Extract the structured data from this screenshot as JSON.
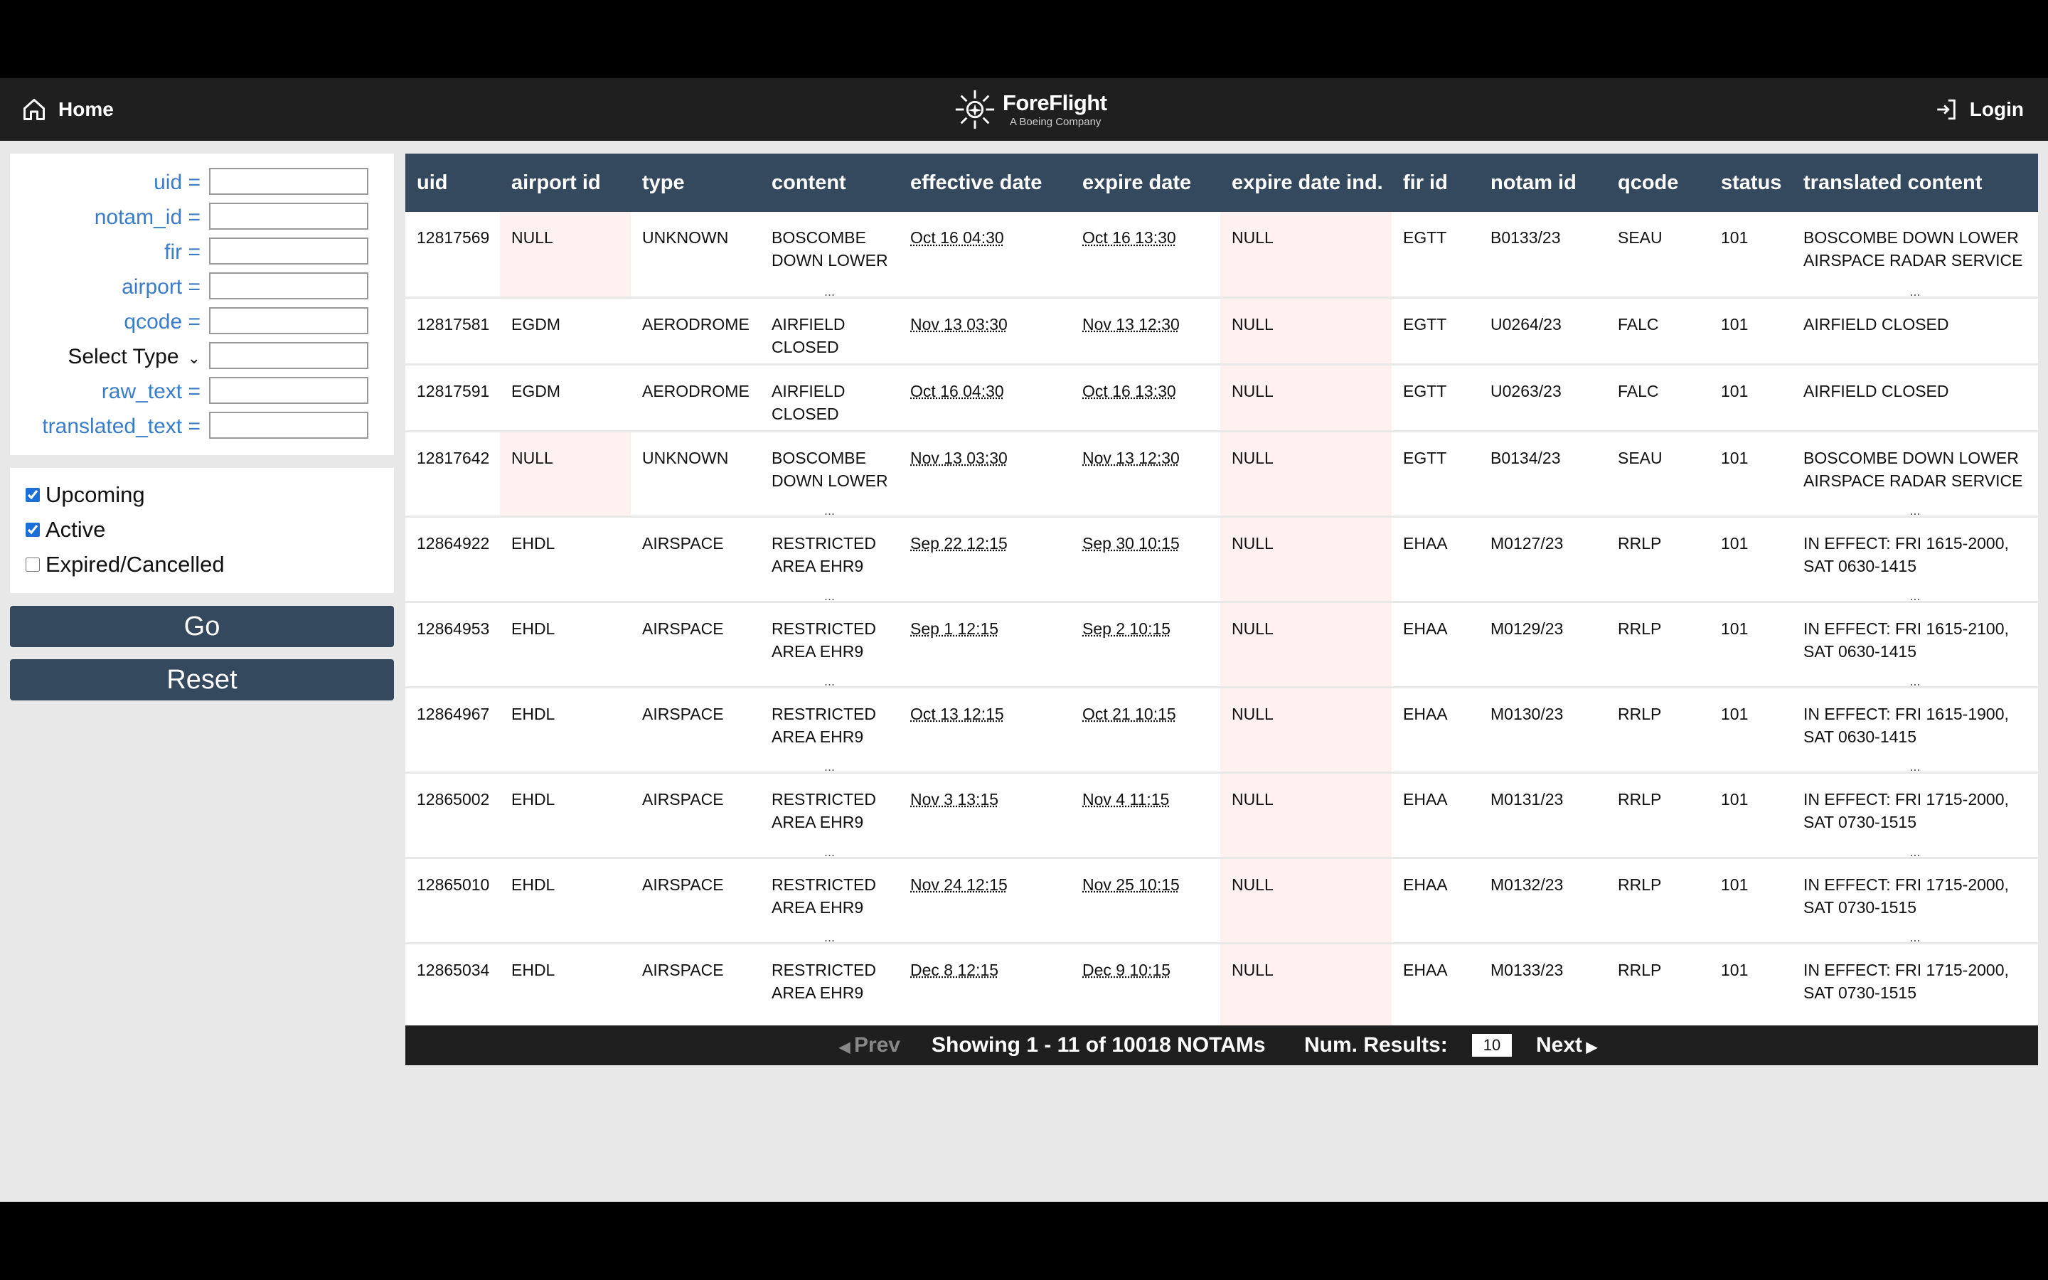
{
  "nav": {
    "home_label": "Home",
    "logo_name": "ForeFlight",
    "logo_sub": "A Boeing Company",
    "login_label": "Login"
  },
  "filters": {
    "uid_label": "uid =",
    "notam_id_label": "notam_id =",
    "fir_label": "fir =",
    "airport_label": "airport =",
    "qcode_label": "qcode =",
    "type_select_label": "Select Type",
    "raw_text_label": "raw_text =",
    "translated_text_label": "translated_text ="
  },
  "statuses": {
    "upcoming": "Upcoming",
    "active": "Active",
    "expired": "Expired/Cancelled"
  },
  "buttons": {
    "go": "Go",
    "reset": "Reset"
  },
  "table": {
    "headers": [
      "uid",
      "airport id",
      "type",
      "content",
      "effective date",
      "expire date",
      "expire date ind.",
      "fir id",
      "notam id",
      "qcode",
      "status",
      "translated content"
    ],
    "rows": [
      [
        "12817569",
        "NULL",
        "UNKNOWN",
        "BOSCOMBE DOWN LOWER",
        "Oct 16 04:30",
        "Oct 16 13:30",
        "NULL",
        "EGTT",
        "B0133/23",
        "SEAU",
        "101",
        "BOSCOMBE DOWN LOWER AIRSPACE RADAR SERVICE"
      ],
      [
        "12817581",
        "EGDM",
        "AERODROME",
        "AIRFIELD CLOSED",
        "Nov 13 03:30",
        "Nov 13 12:30",
        "NULL",
        "EGTT",
        "U0264/23",
        "FALC",
        "101",
        "AIRFIELD CLOSED"
      ],
      [
        "12817591",
        "EGDM",
        "AERODROME",
        "AIRFIELD CLOSED",
        "Oct 16 04:30",
        "Oct 16 13:30",
        "NULL",
        "EGTT",
        "U0263/23",
        "FALC",
        "101",
        "AIRFIELD CLOSED"
      ],
      [
        "12817642",
        "NULL",
        "UNKNOWN",
        "BOSCOMBE DOWN LOWER",
        "Nov 13 03:30",
        "Nov 13 12:30",
        "NULL",
        "EGTT",
        "B0134/23",
        "SEAU",
        "101",
        "BOSCOMBE DOWN LOWER AIRSPACE RADAR SERVICE"
      ],
      [
        "12864922",
        "EHDL",
        "AIRSPACE",
        "RESTRICTED AREA EHR9",
        "Sep 22 12:15",
        "Sep 30 10:15",
        "NULL",
        "EHAA",
        "M0127/23",
        "RRLP",
        "101",
        "IN EFFECT: FRI 1615-2000, SAT 0630-1415"
      ],
      [
        "12864953",
        "EHDL",
        "AIRSPACE",
        "RESTRICTED AREA EHR9",
        "Sep 1 12:15",
        "Sep 2 10:15",
        "NULL",
        "EHAA",
        "M0129/23",
        "RRLP",
        "101",
        "IN EFFECT: FRI 1615-2100, SAT 0630-1415"
      ],
      [
        "12864967",
        "EHDL",
        "AIRSPACE",
        "RESTRICTED AREA EHR9",
        "Oct 13 12:15",
        "Oct 21 10:15",
        "NULL",
        "EHAA",
        "M0130/23",
        "RRLP",
        "101",
        "IN EFFECT: FRI 1615-1900, SAT 0630-1415"
      ],
      [
        "12865002",
        "EHDL",
        "AIRSPACE",
        "RESTRICTED AREA EHR9",
        "Nov 3 13:15",
        "Nov 4 11:15",
        "NULL",
        "EHAA",
        "M0131/23",
        "RRLP",
        "101",
        "IN EFFECT: FRI 1715-2000, SAT 0730-1515"
      ],
      [
        "12865010",
        "EHDL",
        "AIRSPACE",
        "RESTRICTED AREA EHR9",
        "Nov 24 12:15",
        "Nov 25 10:15",
        "NULL",
        "EHAA",
        "M0132/23",
        "RRLP",
        "101",
        "IN EFFECT: FRI 1715-2000, SAT 0730-1515"
      ],
      [
        "12865034",
        "EHDL",
        "AIRSPACE",
        "RESTRICTED AREA EHR9",
        "Dec 8 12:15",
        "Dec 9 10:15",
        "NULL",
        "EHAA",
        "M0133/23",
        "RRLP",
        "101",
        "IN EFFECT: FRI 1715-2000, SAT 0730-1515"
      ]
    ],
    "truncated": [
      [
        false,
        false,
        false,
        true,
        false,
        false,
        false,
        false,
        false,
        false,
        false,
        true
      ],
      [
        false,
        false,
        false,
        false,
        false,
        false,
        false,
        false,
        false,
        false,
        false,
        false
      ],
      [
        false,
        false,
        false,
        false,
        false,
        false,
        false,
        false,
        false,
        false,
        false,
        false
      ],
      [
        false,
        false,
        false,
        true,
        false,
        false,
        false,
        false,
        false,
        false,
        false,
        true
      ],
      [
        false,
        false,
        false,
        true,
        false,
        false,
        false,
        false,
        false,
        false,
        false,
        true
      ],
      [
        false,
        false,
        false,
        true,
        false,
        false,
        false,
        false,
        false,
        false,
        false,
        true
      ],
      [
        false,
        false,
        false,
        true,
        false,
        false,
        false,
        false,
        false,
        false,
        false,
        true
      ],
      [
        false,
        false,
        false,
        true,
        false,
        false,
        false,
        false,
        false,
        false,
        false,
        true
      ],
      [
        false,
        false,
        false,
        true,
        false,
        false,
        false,
        false,
        false,
        false,
        false,
        true
      ],
      [
        false,
        false,
        false,
        true,
        false,
        false,
        false,
        false,
        false,
        false,
        false,
        true
      ]
    ]
  },
  "pagination": {
    "prev_label": "Prev",
    "showing_text": "Showing 1 - 11 of 10018 NOTAMs",
    "num_results_label": "Num. Results:",
    "num_results_value": "10",
    "next_label": "Next"
  },
  "ellipsis": "..."
}
